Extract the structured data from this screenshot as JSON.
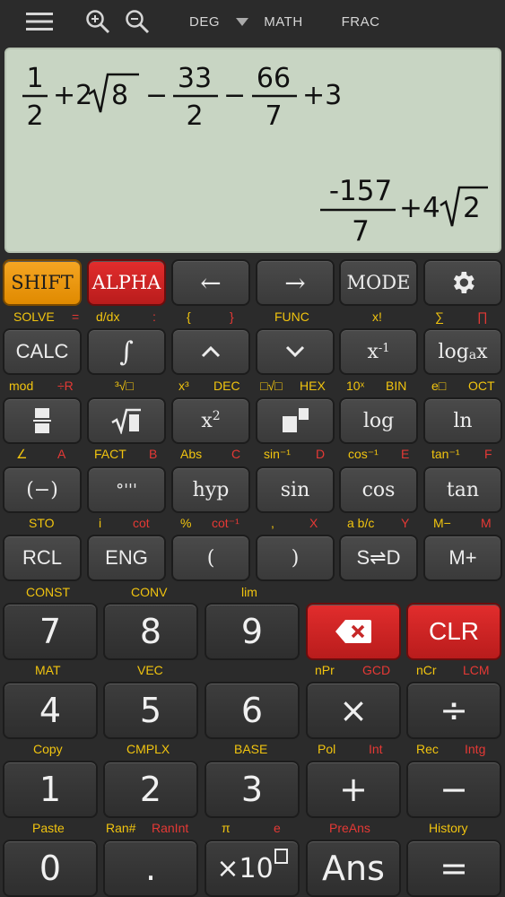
{
  "topbar": {
    "deg": "DEG",
    "math": "MATH",
    "frac": "FRAC"
  },
  "display": {
    "input_expression": "1/2 + 2√8 − 33/2 − 66/7 + 3",
    "result": "-157/7 + 4√2",
    "frac1_num": "1",
    "frac1_den": "2",
    "plus1": "+2",
    "root1": "8",
    "minus1": "−",
    "frac2_num": "33",
    "frac2_den": "2",
    "minus2": "−",
    "frac3_num": "66",
    "frac3_den": "7",
    "tail": "+3",
    "res_num": "-157",
    "res_den": "7",
    "res_tail": "+4",
    "res_root": "2"
  },
  "row1": {
    "shift": "SHIFT",
    "alpha": "ALPHA",
    "left": "←",
    "right": "→",
    "mode": "MODE"
  },
  "row1_labels": {
    "solve": "SOLVE",
    "eq": "=",
    "ddx": "d/dx",
    "colon": ":",
    "lbrace": "{",
    "rbrace": "}",
    "func": "FUNC",
    "fact": "x!",
    "sum": "∑",
    "prod": "∏"
  },
  "row2": {
    "calc": "CALC",
    "integral": "∫",
    "up": "^",
    "down": "⌄",
    "inv_base": "x",
    "inv_exp": "-1",
    "log_a": "log",
    "log_sub": "a",
    "log_x": "x"
  },
  "row2_labels": {
    "mod": "mod",
    "divr": "÷R",
    "cuberoot": "³√□",
    "x3": "x³",
    "dec": "DEC",
    "nroot": "□√□",
    "hex": "HEX",
    "tenx": "10ˣ",
    "bin": "BIN",
    "ex": "e□",
    "oct": "OCT"
  },
  "row3": {
    "sq_base": "x",
    "sq_exp": "2",
    "log": "log",
    "ln": "ln"
  },
  "row3_labels": {
    "angle": "∠",
    "a": "A",
    "fact": "FACT",
    "b": "B",
    "abs": "Abs",
    "c": "C",
    "asin": "sin⁻¹",
    "d": "D",
    "acos": "cos⁻¹",
    "e": "E",
    "atan": "tan⁻¹",
    "f": "F"
  },
  "row4": {
    "neg": "(−)",
    "dms": "°'''",
    "hyp": "hyp",
    "sin": "sin",
    "cos": "cos",
    "tan": "tan"
  },
  "row4_labels": {
    "sto": "STO",
    "i": "i",
    "cot": "cot",
    "pct": "%",
    "acot": "cot⁻¹",
    "comma": ",",
    "x": "X",
    "abc": "a b/c",
    "y": "Y",
    "mminus": "M−",
    "m": "M"
  },
  "row5": {
    "rcl": "RCL",
    "eng": "ENG",
    "lparen": "(",
    "rparen": ")",
    "sd": "S⇌D",
    "mplus": "M+"
  },
  "row5_labels": {
    "const": "CONST",
    "conv": "CONV",
    "lim": "lim"
  },
  "row6": {
    "n7": "7",
    "n8": "8",
    "n9": "9",
    "clr": "CLR"
  },
  "row6_labels": {
    "mat": "MAT",
    "vec": "VEC",
    "npr": "nPr",
    "gcd": "GCD",
    "ncr": "nCr",
    "lcm": "LCM"
  },
  "row7": {
    "n4": "4",
    "n5": "5",
    "n6": "6",
    "mul": "×",
    "div": "÷"
  },
  "row7_labels": {
    "copy": "Copy",
    "cmplx": "CMPLX",
    "base": "BASE",
    "pol": "Pol",
    "int": "Int",
    "rec": "Rec",
    "intg": "Intg"
  },
  "row8": {
    "n1": "1",
    "n2": "2",
    "n3": "3",
    "plus": "+",
    "minus": "−"
  },
  "row8_labels": {
    "paste": "Paste",
    "ran": "Ran#",
    "ranint": "RanInt",
    "pi": "π",
    "e": "e",
    "preans": "PreAns",
    "history": "History"
  },
  "row9": {
    "n0": "0",
    "dot": ".",
    "exp10": "×10",
    "ans": "Ans",
    "eq": "="
  },
  "colors": {
    "shift": "#f5a623",
    "alpha": "#d32f2f",
    "yellow_label": "#f1c40f",
    "red_label": "#e53935",
    "display_bg": "#c8d5c3"
  }
}
